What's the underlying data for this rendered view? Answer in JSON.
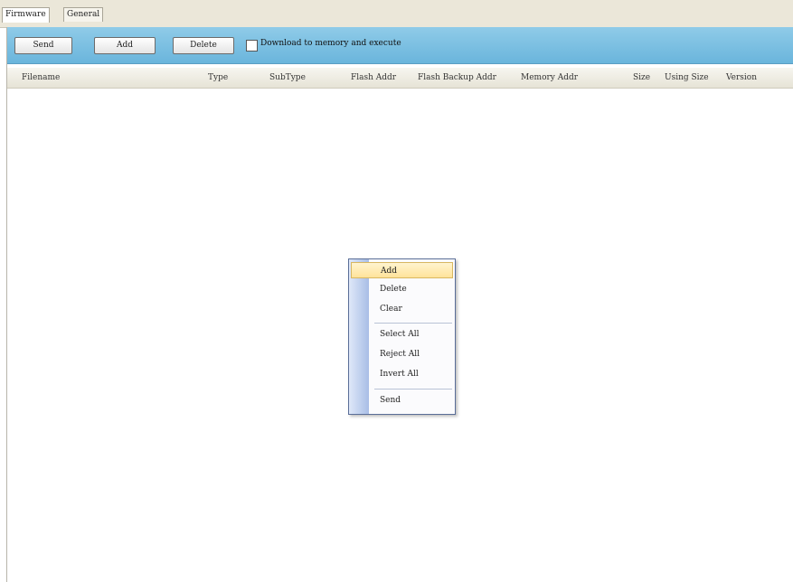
{
  "tabs": [
    {
      "label": "Firmware"
    },
    {
      "label": "General"
    }
  ],
  "toolbar": {
    "send_label": "Send",
    "add_label": "Add",
    "delete_label": "Delete",
    "checkbox_label": "Download to memory and execute",
    "checkbox_checked": false
  },
  "columns": [
    {
      "label": "Filename"
    },
    {
      "label": "Type"
    },
    {
      "label": "SubType"
    },
    {
      "label": "Flash Addr"
    },
    {
      "label": "Flash Backup Addr"
    },
    {
      "label": "Memory Addr"
    },
    {
      "label": "Size"
    },
    {
      "label": "Using Size"
    },
    {
      "label": "Version"
    }
  ],
  "context_menu": {
    "items": [
      {
        "label": "Add"
      },
      {
        "label": "Delete"
      },
      {
        "label": "Clear"
      },
      {
        "label": "Select All"
      },
      {
        "label": "Reject All"
      },
      {
        "label": "Invert All"
      },
      {
        "label": "Send"
      }
    ]
  },
  "colors": {
    "toolbar": "#7cc0e3",
    "menu_highlight": "#ffe39a",
    "menu_gutter": "#a8bde6"
  }
}
